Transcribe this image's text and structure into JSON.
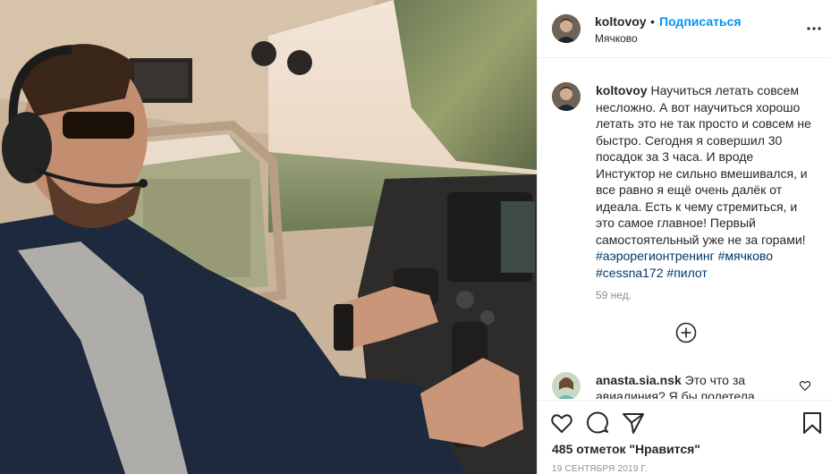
{
  "post": {
    "username": "koltovoy",
    "dot": "•",
    "follow_label": "Подписаться",
    "location": "Мячково"
  },
  "caption": {
    "username": "koltovoy",
    "text": "Научиться летать совсем несложно. А вот научиться хорошо летать это не так просто и совсем не быстро. Сегодня я совершил 30 посадок за 3 часа. И вроде Инстуктор не сильно вмешивался, и все равно я ещё очень далёк от идеала. Есть к чему стремиться, и это самое главное! Первый самостоятельный уже не за горами!",
    "hashtags": [
      "#аэрорегионтренинг",
      "#мячково",
      "#cessna172",
      "#пилот"
    ],
    "time": "59 нед."
  },
  "comment": {
    "username": "anasta.sia.nsk",
    "text": "Это что за авиалиния? Я бы полетела"
  },
  "footer": {
    "likes": "485 отметок \"Нравится\"",
    "date": "19 СЕНТЯБРЯ 2019 Г."
  },
  "icons": {
    "more": "more-options-icon",
    "load_more": "plus-circle-icon",
    "comment_like": "heart-icon",
    "like": "heart-icon",
    "comment": "comment-icon",
    "share": "paper-plane-icon",
    "save": "bookmark-icon"
  },
  "colors": {
    "follow": "#0095f6",
    "hashtag": "#00376b",
    "muted": "#8e8e8e"
  }
}
